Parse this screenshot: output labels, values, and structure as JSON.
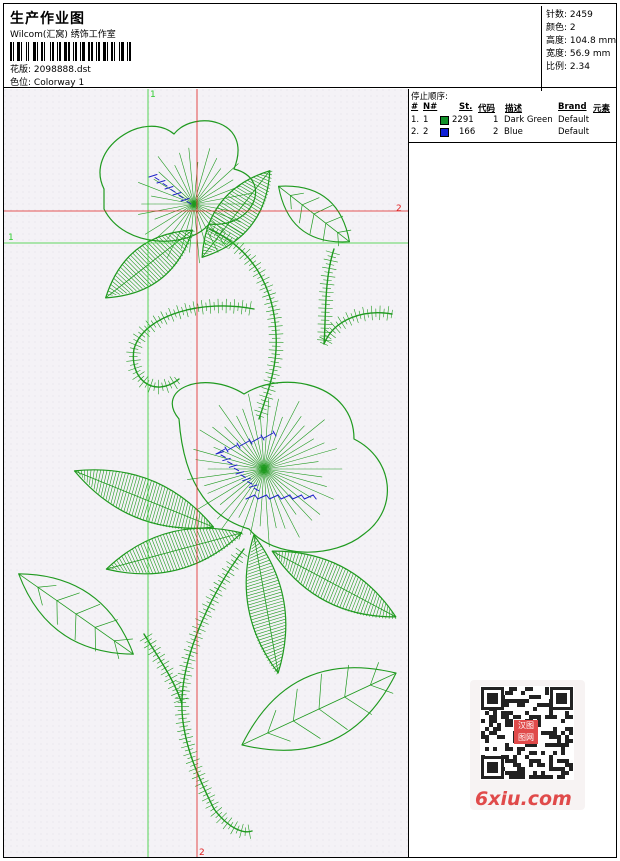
{
  "header": {
    "title": "生产作业图",
    "studio": "Wilcom(汇窝) 绣饰工作室",
    "design_label": "花版:",
    "design_value": "2098888.dst",
    "colorway_label": "色位:",
    "colorway_value": "Colorway 1"
  },
  "stats": [
    {
      "label": "针数:",
      "value": "2459"
    },
    {
      "label": "颜色:",
      "value": "2"
    },
    {
      "label": "高度:",
      "value": "104.8 mm"
    },
    {
      "label": "宽度:",
      "value": "56.9 mm"
    },
    {
      "label": "比例:",
      "value": "2.34"
    }
  ],
  "stop_sequence": {
    "title": "停止顺序:",
    "columns": [
      "#",
      "N#",
      "St.",
      "代码",
      "描述",
      "Brand",
      "元素"
    ],
    "rows": [
      {
        "num": "1.",
        "n": "1",
        "color": "#12912a",
        "stitches": "2291",
        "code": "1",
        "desc": "Dark Green",
        "brand": "Default"
      },
      {
        "num": "2.",
        "n": "2",
        "color": "#0f1fd6",
        "stitches": "166",
        "code": "2",
        "desc": "Blue",
        "brand": "Default"
      }
    ]
  },
  "guides": {
    "h1": "1",
    "h2": "2",
    "v1": "1",
    "v2": "2"
  },
  "colors": {
    "thread_green": "#1f9a1f",
    "thread_blue": "#1d22c8",
    "guide_green": "#2ecc2e",
    "guide_red": "#e02020",
    "watermark_red": "#e04a4a"
  },
  "watermark": {
    "site": "6xiu.com",
    "stamp": "汉图 图网"
  }
}
